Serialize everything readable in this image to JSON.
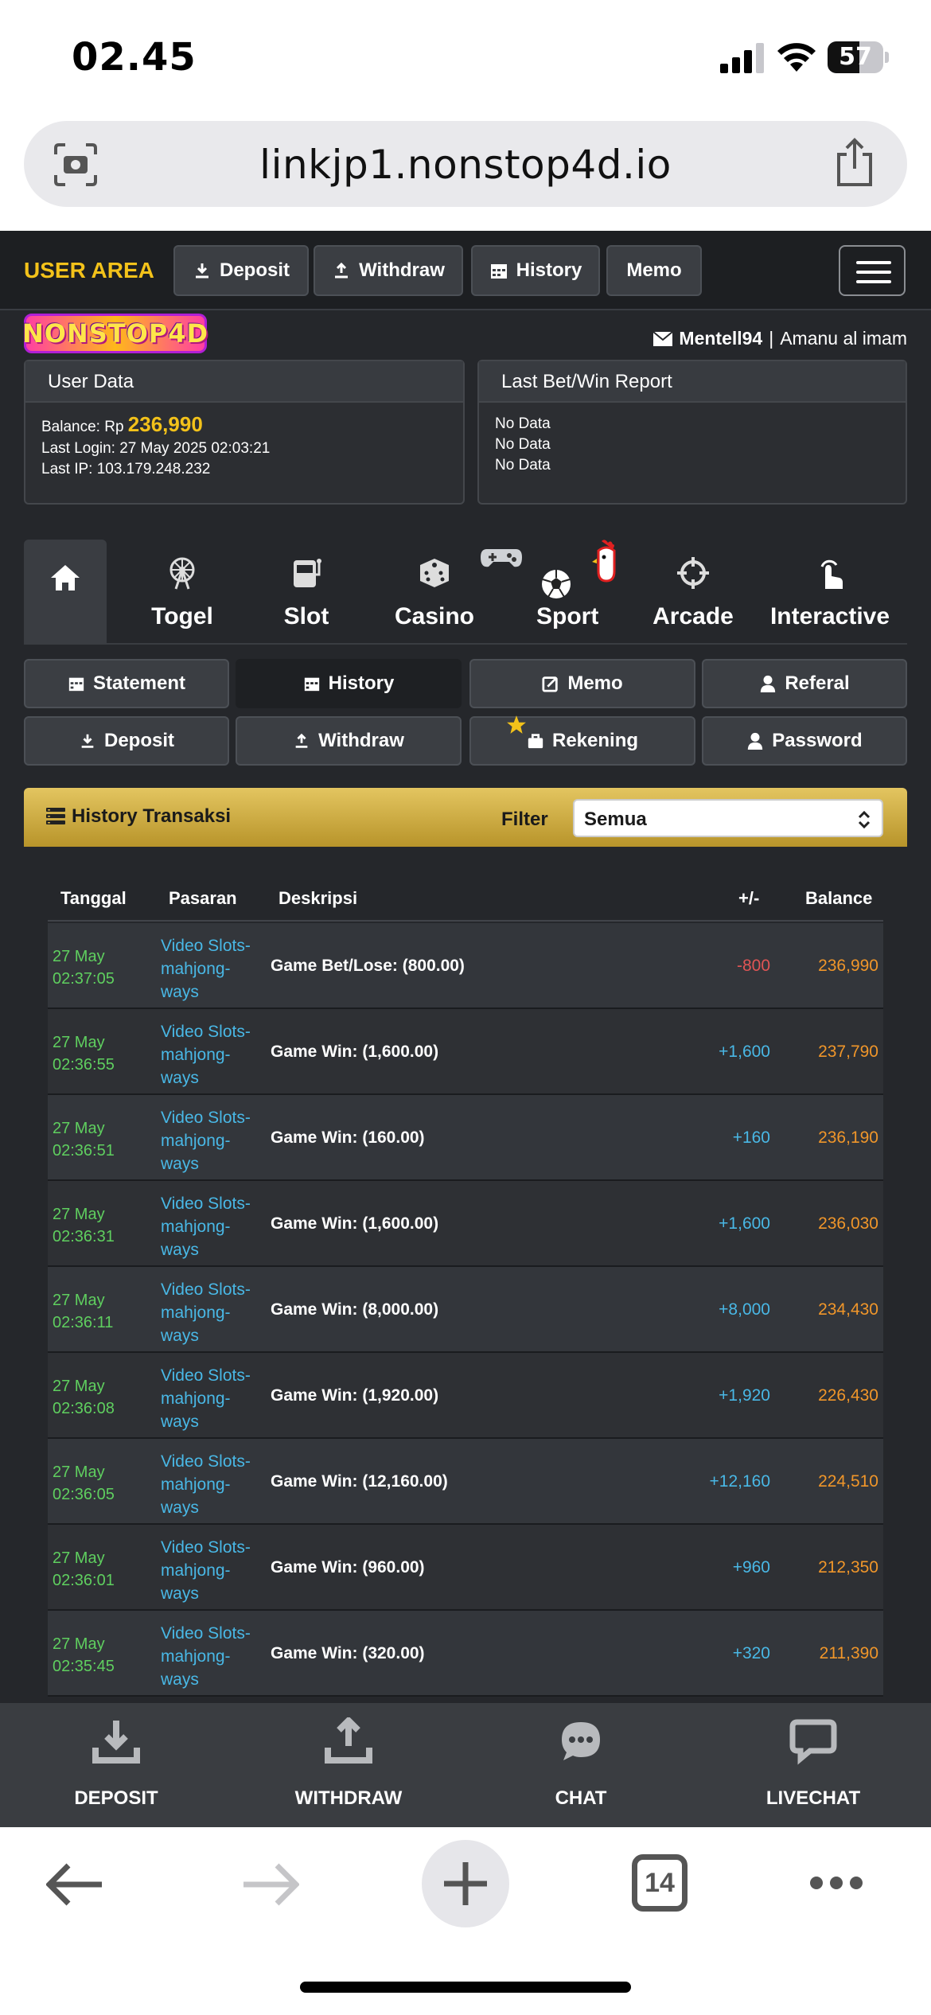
{
  "status": {
    "time": "02.45",
    "battery": "57",
    "battery_level": 0.57
  },
  "browser": {
    "url": "linkjp1.nonstop4d.io",
    "tab_count": "14"
  },
  "nav": {
    "user_area": "USER AREA",
    "buttons": [
      "Deposit",
      "Withdraw",
      "History",
      "Memo"
    ]
  },
  "logo_text": "NONSTOP4D",
  "user": {
    "username": "Mentell94",
    "separator": "|",
    "name": "Amanu al imam"
  },
  "user_data": {
    "title": "User Data",
    "balance_label": "Balance: Rp",
    "balance": "236,990",
    "last_login": "Last Login: 27 May 2025 02:03:21",
    "last_ip": "Last IP: 103.179.248.232"
  },
  "report": {
    "title": "Last Bet/Win Report",
    "lines": [
      "No Data",
      "No Data",
      "No Data"
    ]
  },
  "game_tabs": [
    "Togel",
    "Slot",
    "Casino",
    "Sport",
    "Arcade",
    "Interactive"
  ],
  "submenu": [
    "Statement",
    "History",
    "Memo",
    "Referal",
    "Deposit",
    "Withdraw",
    "Rekening",
    "Password"
  ],
  "history": {
    "title": "History Transaksi",
    "filter_label": "Filter",
    "filter_value": "Semua",
    "columns": [
      "Tanggal",
      "Pasaran",
      "Deskripsi",
      "+/-",
      "Balance"
    ],
    "rows": [
      {
        "date": "27 May",
        "time": "02:37:05",
        "pasaran": "Video Slots-mahjong-ways",
        "desc": "Game Bet/Lose: (800.00)",
        "amount": "-800",
        "balance": "236,990"
      },
      {
        "date": "27 May",
        "time": "02:36:55",
        "pasaran": "Video Slots-mahjong-ways",
        "desc": "Game Win: (1,600.00)",
        "amount": "+1,600",
        "balance": "237,790"
      },
      {
        "date": "27 May",
        "time": "02:36:51",
        "pasaran": "Video Slots-mahjong-ways",
        "desc": "Game Win: (160.00)",
        "amount": "+160",
        "balance": "236,190"
      },
      {
        "date": "27 May",
        "time": "02:36:31",
        "pasaran": "Video Slots-mahjong-ways",
        "desc": "Game Win: (1,600.00)",
        "amount": "+1,600",
        "balance": "236,030"
      },
      {
        "date": "27 May",
        "time": "02:36:11",
        "pasaran": "Video Slots-mahjong-ways",
        "desc": "Game Win: (8,000.00)",
        "amount": "+8,000",
        "balance": "234,430"
      },
      {
        "date": "27 May",
        "time": "02:36:08",
        "pasaran": "Video Slots-mahjong-ways",
        "desc": "Game Win: (1,920.00)",
        "amount": "+1,920",
        "balance": "226,430"
      },
      {
        "date": "27 May",
        "time": "02:36:05",
        "pasaran": "Video Slots-mahjong-ways",
        "desc": "Game Win: (12,160.00)",
        "amount": "+12,160",
        "balance": "224,510"
      },
      {
        "date": "27 May",
        "time": "02:36:01",
        "pasaran": "Video Slots-mahjong-ways",
        "desc": "Game Win: (960.00)",
        "amount": "+960",
        "balance": "212,350"
      },
      {
        "date": "27 May",
        "time": "02:35:45",
        "pasaran": "Video Slots-mahjong-ways",
        "desc": "Game Win: (320.00)",
        "amount": "+320",
        "balance": "211,390"
      }
    ]
  },
  "bottom_nav": [
    "DEPOSIT",
    "WITHDRAW",
    "CHAT",
    "LIVECHAT"
  ],
  "colors": {
    "accent": "#f3c21a",
    "date": "#5fcf5f",
    "link": "#49b8e6",
    "negative": "#e05555",
    "positive": "#49b8e6",
    "balance": "#f0962a"
  }
}
